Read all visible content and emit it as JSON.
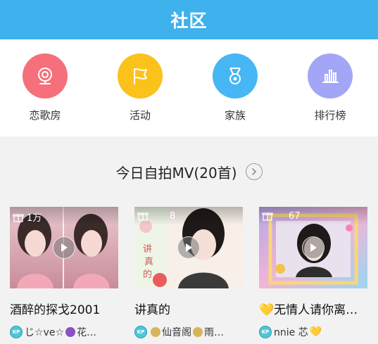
{
  "header": {
    "title": "社区"
  },
  "nav": {
    "items": [
      {
        "label": "恋歌房",
        "color": "#f5707a",
        "icon": "webcam-icon"
      },
      {
        "label": "活动",
        "color": "#fbc21c",
        "icon": "flag-icon"
      },
      {
        "label": "家族",
        "color": "#46b7f4",
        "icon": "medal-icon"
      },
      {
        "label": "排行榜",
        "color": "#a3a6f6",
        "icon": "bar-chart-icon"
      }
    ]
  },
  "section": {
    "title": "今日自拍MV(20首)"
  },
  "cards": [
    {
      "views": "1万",
      "title": "酒醉的探戈2001",
      "user": "じ☆ve☆",
      "user_tail": "花…"
    },
    {
      "views": "8",
      "title": "讲真的",
      "user": "仙音阁",
      "user_tail": "雨…"
    },
    {
      "views": "67",
      "title": "无情人请你离…",
      "user": "nnie 芯",
      "user_tail": ""
    }
  ],
  "colors": {
    "accent": "#3fb1ec"
  }
}
